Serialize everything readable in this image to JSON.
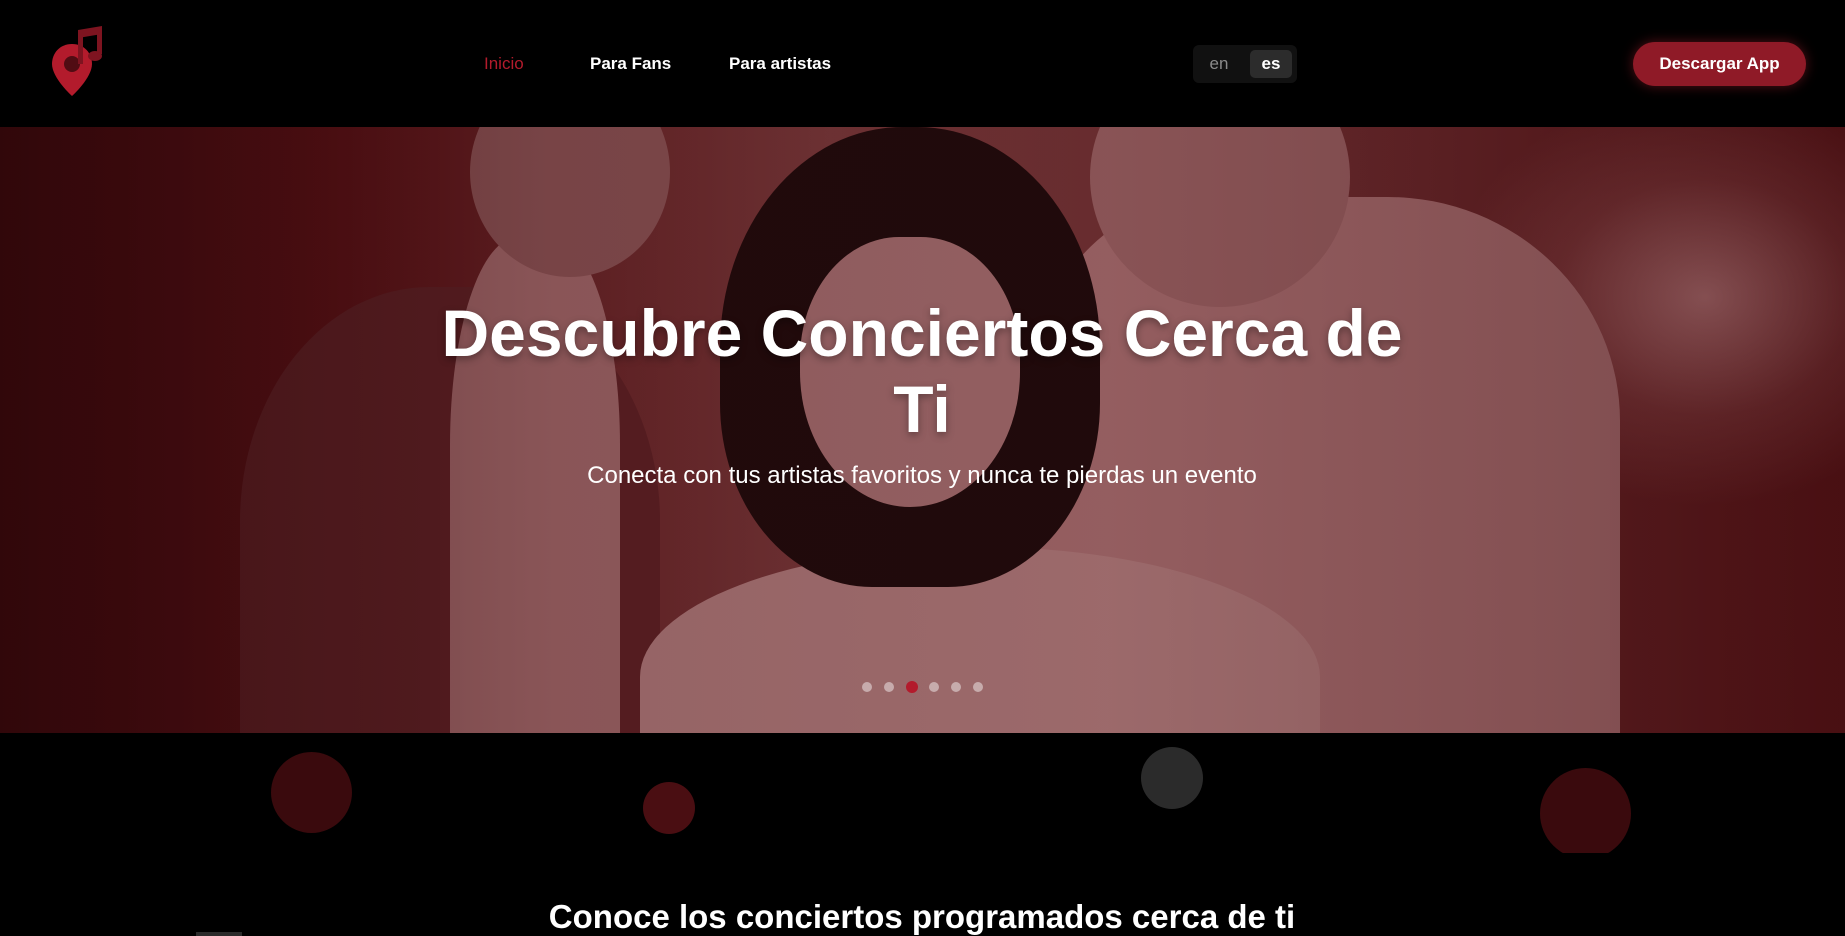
{
  "header": {
    "logo_icon": "music-note-location-pin",
    "brand_color": "#b31b2c",
    "nav": [
      {
        "label": "Inicio",
        "active": true
      },
      {
        "label": "Para Fans",
        "active": false
      },
      {
        "label": "Para artistas",
        "active": false
      }
    ],
    "languages": {
      "en": "en",
      "es": "es",
      "selected": "es"
    },
    "download_label": "Descargar App"
  },
  "hero": {
    "title": "Descubre Conciertos Cerca de Ti",
    "subtitle": "Conecta con tus artistas favoritos y nunca te pierdas un evento",
    "carousel": {
      "slides": 6,
      "active_index": 3
    }
  },
  "section": {
    "title": "Conoce los conciertos programados cerca de ti"
  }
}
